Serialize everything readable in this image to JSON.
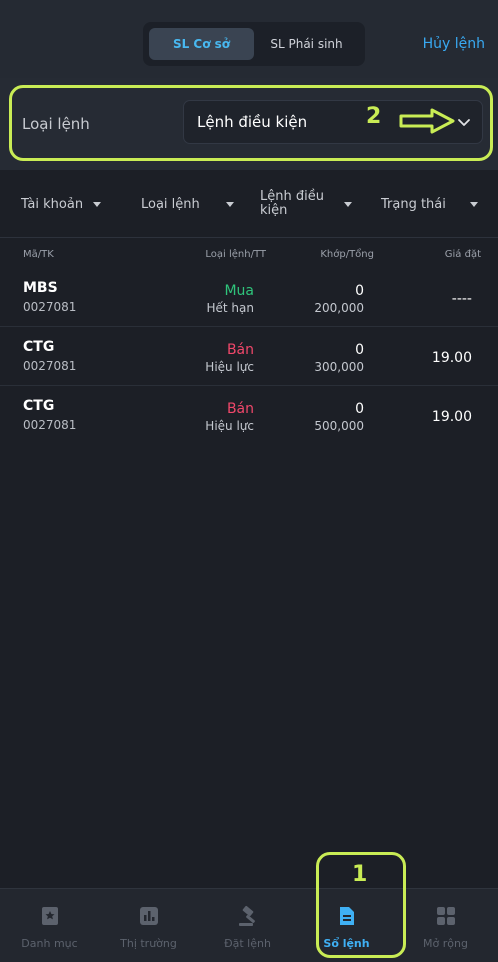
{
  "header": {
    "segments": [
      "SL Cơ sở",
      "SL Phái sinh"
    ],
    "active_segment": "SL Cơ sở",
    "cancel_label": "Hủy lệnh"
  },
  "order_type_row": {
    "label": "Loại lệnh",
    "selected_value": "Lệnh điều kiện"
  },
  "filters": [
    {
      "label": "Tài khoản"
    },
    {
      "label": "Loại lệnh"
    },
    {
      "label_line1": "Lệnh điều",
      "label_line2": "kiện"
    },
    {
      "label": "Trạng thái"
    }
  ],
  "table": {
    "columns": [
      "Mã/TK",
      "Loại lệnh/TT",
      "Khớp/Tổng",
      "Giá đặt"
    ],
    "rows": [
      {
        "symbol": "MBS",
        "account": "0027081",
        "side": "Mua",
        "status": "Hết hạn",
        "matched": "0",
        "total": "200,000",
        "price": "----"
      },
      {
        "symbol": "CTG",
        "account": "0027081",
        "side": "Bán",
        "status": "Hiệu lực",
        "matched": "0",
        "total": "300,000",
        "price": "19.00"
      },
      {
        "symbol": "CTG",
        "account": "0027081",
        "side": "Bán",
        "status": "Hiệu lực",
        "matched": "0",
        "total": "500,000",
        "price": "19.00"
      }
    ]
  },
  "annotations": {
    "label_1": "1",
    "label_2": "2",
    "color": "#c9ec55"
  },
  "bottom_nav": {
    "items": [
      {
        "label": "Danh mục",
        "icon": "bookmark-icon"
      },
      {
        "label": "Thị trường",
        "icon": "bar-chart-icon"
      },
      {
        "label": "Đặt lệnh",
        "icon": "gavel-icon"
      },
      {
        "label": "Sổ lệnh",
        "icon": "document-icon"
      },
      {
        "label": "Mở rộng",
        "icon": "grid-icon"
      }
    ],
    "active": "Sổ lệnh"
  },
  "colors": {
    "accent": "#3fb0f4",
    "buy": "#2fc47b",
    "sell": "#f0476a",
    "background": "#1c1f26"
  }
}
